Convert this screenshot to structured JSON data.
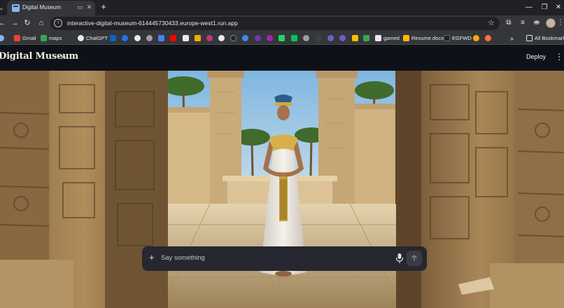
{
  "browser": {
    "tab": {
      "title": "Digital Museum"
    },
    "url": "interactive-digital-museum-614445730433.europe-west1.run.app",
    "bookmarks": {
      "gmail": "Gmail",
      "maps": "maps",
      "chatgpt": "ChatGPT",
      "gamed": "gamed",
      "resume": "Resume.docx",
      "egfwd": "EGFWD",
      "all": "All Bookmarks"
    }
  },
  "app": {
    "logo": "Digital Museum",
    "deploy": "Deploy"
  },
  "chat": {
    "placeholder": "Say something"
  },
  "colors": {
    "app_bg": "#0e1117",
    "chat_bg": "#262730",
    "browser_frame": "#35363a"
  }
}
